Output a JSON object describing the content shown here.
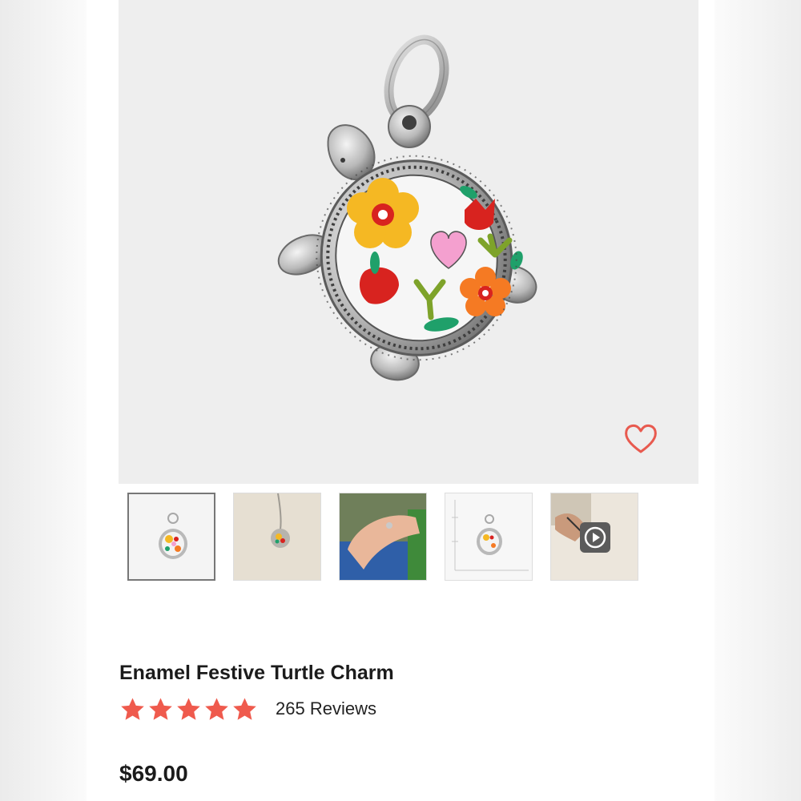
{
  "product": {
    "title": "Enamel Festive Turtle Charm",
    "rating": 5,
    "rating_max": 5,
    "reviews_label": "265 Reviews",
    "price": "$69.00"
  },
  "gallery": {
    "selected_index": 0,
    "thumbnails": [
      {
        "name": "product-front",
        "type": "image"
      },
      {
        "name": "on-necklace",
        "type": "image"
      },
      {
        "name": "on-wrist",
        "type": "image"
      },
      {
        "name": "size-chart",
        "type": "image"
      },
      {
        "name": "crafting-video",
        "type": "video"
      }
    ]
  },
  "icons": {
    "wishlist": "heart-outline-icon",
    "star": "star-icon",
    "play": "play-icon"
  },
  "colors": {
    "accent": "#e85a4f",
    "star": "#ef5a4d",
    "text": "#1b1b1b",
    "background": "#eeeeee"
  }
}
